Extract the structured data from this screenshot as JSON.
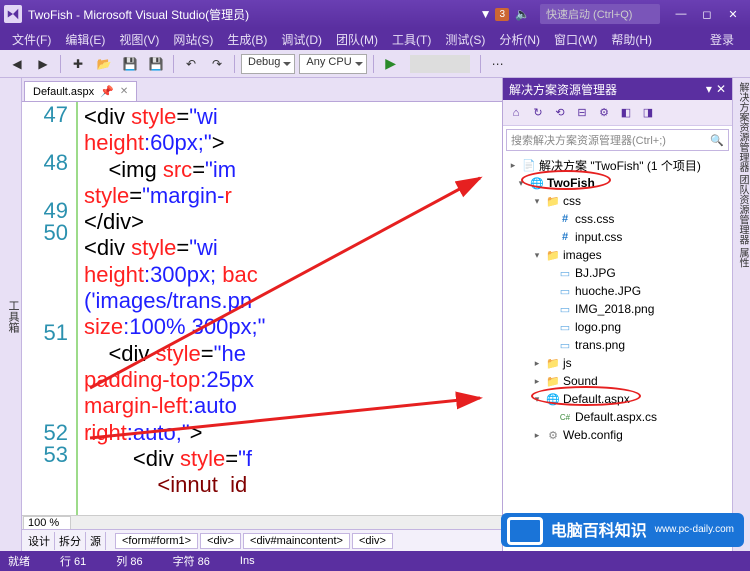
{
  "window": {
    "title": "TwoFish - Microsoft Visual Studio(管理员)",
    "notif_count": "3",
    "quick_launch_placeholder": "快速启动 (Ctrl+Q)"
  },
  "menu": {
    "file": "文件(F)",
    "edit": "编辑(E)",
    "view": "视图(V)",
    "site": "网站(S)",
    "build": "生成(B)",
    "debug": "调试(D)",
    "team": "团队(M)",
    "tools": "工具(T)",
    "test": "测试(S)",
    "analyze": "分析(N)",
    "window": "窗口(W)",
    "help": "帮助(H)",
    "login": "登录"
  },
  "toolbar": {
    "config": "Debug",
    "platform": "Any CPU"
  },
  "toolbox_label": "工具箱",
  "right_label": "解决方案资源管理器  团队资源管理器  属性",
  "tab": {
    "name": "Default.aspx"
  },
  "gutter": {
    "l47": "47",
    "l48": "48",
    "l49": "49",
    "l50": "50",
    "l51": "51",
    "l52": "52",
    "l53": "53"
  },
  "code": {
    "l47a": "<div ",
    "l47b": "style",
    "l47c": "=",
    "l47d": "\"wi",
    "l47e": "height",
    "l47f": ":60px;\"",
    "l47g": ">",
    "l48a": "    <img ",
    "l48b": "src",
    "l48c": "=",
    "l48d": "\"im",
    "l48e": "style",
    "l48f": "=",
    "l48g": "\"margin-",
    "l48h": "r",
    "l49a": "</div>",
    "l50a": "<div ",
    "l50b": "style",
    "l50c": "=",
    "l50d": "\"wi",
    "l50e": "height",
    "l50f": ":300px; ",
    "l50g": "bac",
    "l50h": "('images/trans.pn",
    "l50i": "size",
    "l50j": ":100% 300px;\"",
    "l51a": "    <div ",
    "l51b": "style",
    "l51c": "=",
    "l51d": "\"he",
    "l51e": "padding-top",
    "l51f": ":25px",
    "l51g": "margin-left",
    "l51h": ":auto",
    "l51i": "right",
    "l51j": ":auto;\"",
    "l51k": ">",
    "l52a": "        <div ",
    "l52b": "style",
    "l52c": "=",
    "l52d": "\"f",
    "l53a": "            <innut  id"
  },
  "zoom": "100 %",
  "footer_views": {
    "design": "设计",
    "split": "拆分",
    "source": "源"
  },
  "breadcrumbs": {
    "b1": "<form#form1>",
    "b2": "<div>",
    "b3": "<div#maincontent>",
    "b4": "<div>"
  },
  "solx": {
    "title": "解决方案资源管理器",
    "search_placeholder": "搜索解决方案资源管理器(Ctrl+;)",
    "solution": "解决方案 \"TwoFish\" (1 个项目)",
    "project": "TwoFish",
    "css_folder": "css",
    "css_css": "css.css",
    "input_css": "input.css",
    "images_folder": "images",
    "bj": "BJ.JPG",
    "huoche": "huoche.JPG",
    "img2018": "IMG_2018.png",
    "logo": "logo.png",
    "trans": "trans.png",
    "js": "js",
    "sound": "Sound",
    "default_aspx": "Default.aspx",
    "default_cs": "Default.aspx.cs",
    "web_config": "Web.config"
  },
  "status": {
    "ready": "就绪",
    "line": "行 61",
    "col": "列 86",
    "char": "字符 86",
    "ins": "Ins"
  },
  "watermark": {
    "text": "电脑百科知识",
    "url": "www.pc-daily.com"
  }
}
